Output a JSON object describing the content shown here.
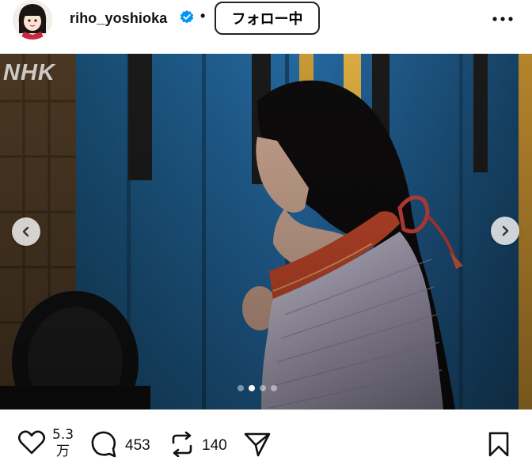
{
  "header": {
    "username": "riho_yoshioka",
    "verified_icon": "verified-badge-icon",
    "separator": "•",
    "follow_label": "フォロー中",
    "more_icon": "more-options-icon"
  },
  "post": {
    "watermark": "NHK",
    "carousel": {
      "total": 4,
      "active_index": 1
    }
  },
  "actions": {
    "like_count_line1": "5.3",
    "like_count_line2": "万",
    "comment_count": "453",
    "repost_count": "140",
    "icons": [
      "heart-icon",
      "comment-icon",
      "repost-icon",
      "share-icon",
      "bookmark-icon"
    ]
  },
  "colors": {
    "verified_blue": "#0095f6",
    "curtain_blue": "#1f5f8c",
    "obi_red": "#c0462a"
  }
}
